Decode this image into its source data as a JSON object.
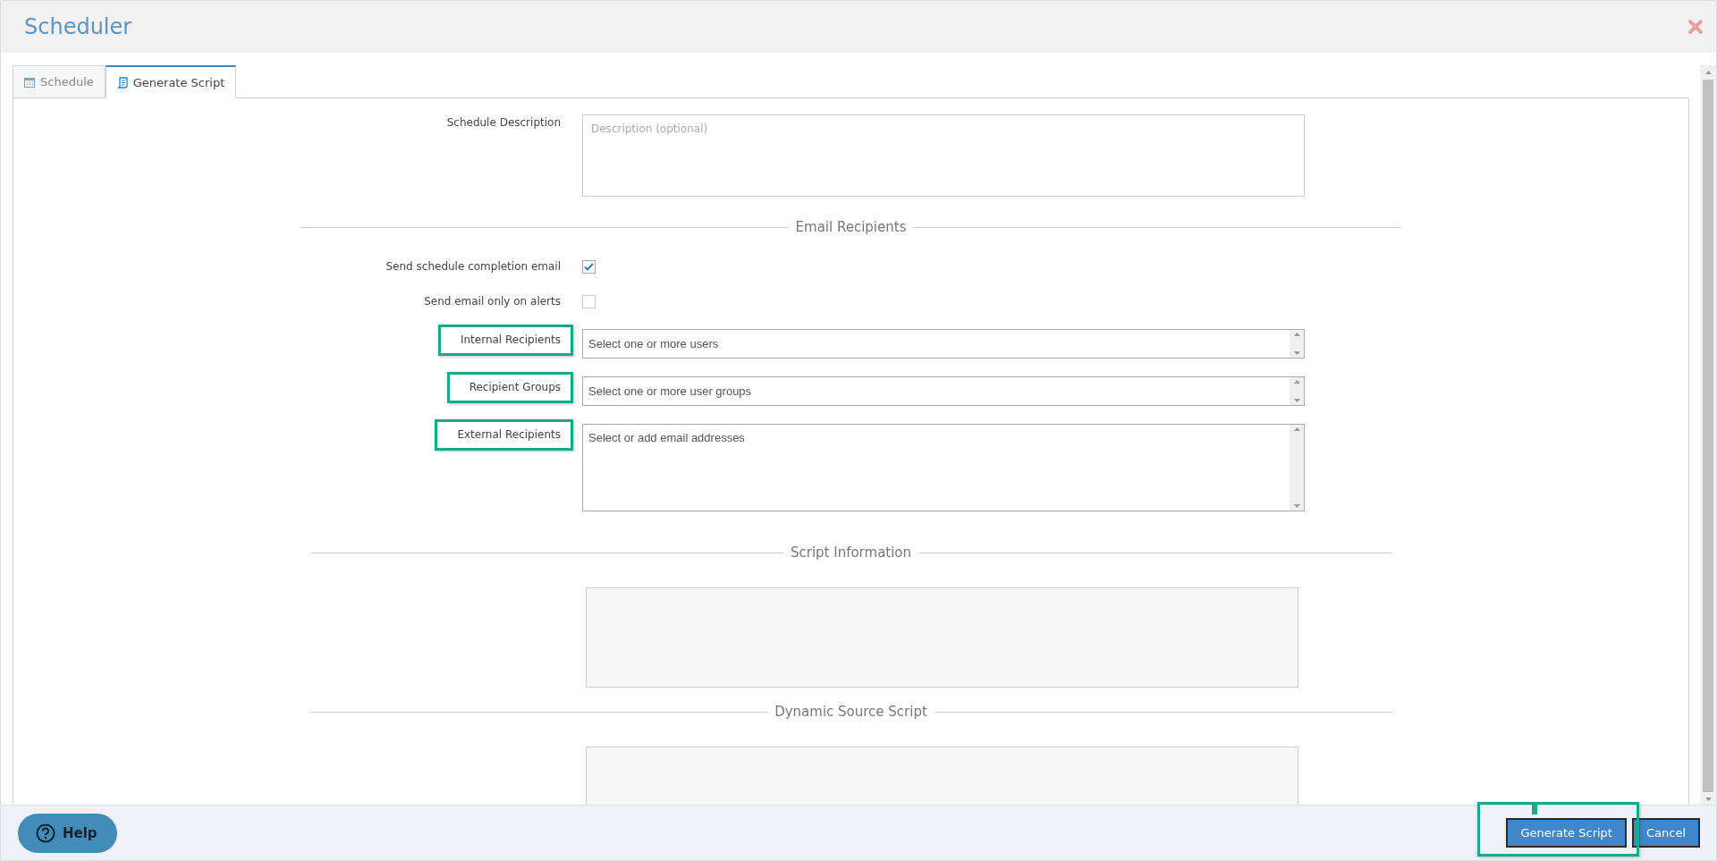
{
  "window": {
    "title": "Scheduler"
  },
  "tabs": [
    {
      "label": "Schedule",
      "selected": false
    },
    {
      "label": "Generate Script",
      "selected": true
    }
  ],
  "description": {
    "label": "Schedule Description",
    "placeholder": "Description (optional)"
  },
  "email_section": {
    "title": "Email Recipients",
    "options": [
      {
        "label": "Send schedule completion email",
        "checked": true
      },
      {
        "label": "Send email only on alerts",
        "checked": false
      }
    ],
    "recipients": [
      {
        "label": "Internal Recipients",
        "placeholder": "Select one or more users",
        "highlighted": true,
        "kind": "single"
      },
      {
        "label": "Recipient Groups",
        "placeholder": "Select one or more user groups",
        "highlighted": true,
        "kind": "single"
      },
      {
        "label": "External Recipients",
        "placeholder": "Select or add email addresses",
        "highlighted": true,
        "kind": "multi"
      }
    ]
  },
  "script_information": {
    "title": "Script Information"
  },
  "dynamic_source_script": {
    "title": "Dynamic Source Script"
  },
  "footer": {
    "help": "Help",
    "buttons": [
      {
        "label": "Generate Script",
        "highlighted": true
      },
      {
        "label": "Cancel",
        "highlighted": false
      }
    ]
  }
}
